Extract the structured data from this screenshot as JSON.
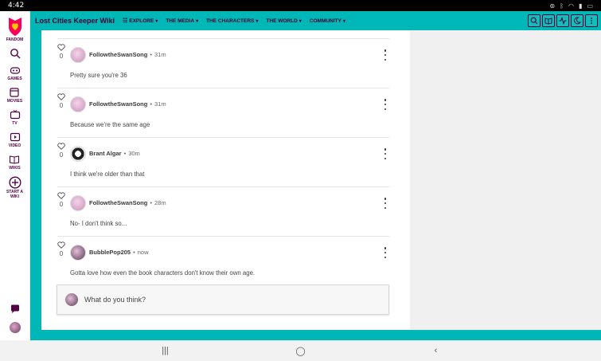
{
  "status_bar": {
    "time": "4:42",
    "icons": [
      "link-icon",
      "bluetooth-icon",
      "wifi-icon",
      "signal-icon",
      "battery-icon"
    ]
  },
  "rail": {
    "logo_label": "FANDOM",
    "items": [
      {
        "label": "",
        "icon": "search-icon"
      },
      {
        "label": "GAMES",
        "icon": "games-icon"
      },
      {
        "label": "MOVIES",
        "icon": "movies-icon"
      },
      {
        "label": "TV",
        "icon": "tv-icon"
      },
      {
        "label": "VIDEO",
        "icon": "video-icon"
      },
      {
        "label": "WIKIS",
        "icon": "wikis-icon"
      },
      {
        "label": "START A WIKI",
        "icon": "plus-circle-icon"
      }
    ]
  },
  "topnav": {
    "wiki_title": "Lost Cities Keeper Wiki",
    "menu": [
      {
        "label": "EXPLORE",
        "icon": "explore-icon"
      },
      {
        "label": "THE MEDIA"
      },
      {
        "label": "THE CHARACTERS"
      },
      {
        "label": "THE WORLD"
      },
      {
        "label": "COMMUNITY"
      }
    ],
    "tools": [
      "search-icon",
      "book-icon",
      "activity-icon",
      "moon-icon",
      "more-vertical-icon"
    ]
  },
  "comments": [
    {
      "likes": "0",
      "user": "FollowtheSwanSong",
      "sep": "•",
      "time": "31m",
      "text": "Pretty sure you're 36"
    },
    {
      "likes": "0",
      "user": "FollowtheSwanSong",
      "sep": "•",
      "time": "31m",
      "text": "Because we're the same age"
    },
    {
      "likes": "0",
      "user": "Brant Algar",
      "sep": "•",
      "time": "30m",
      "text": "I think we're older than that"
    },
    {
      "likes": "0",
      "user": "FollowtheSwanSong",
      "sep": "•",
      "time": "28m",
      "text": "No- I don't think so..."
    },
    {
      "likes": "0",
      "user": "BubblePop205",
      "sep": "•",
      "time": "now",
      "text": "Gotta love how even the book characters don't know their own age."
    }
  ],
  "reply": {
    "placeholder": "What do you think?"
  },
  "android_nav": {
    "recent": "|||",
    "home": "◯",
    "back": "‹"
  }
}
